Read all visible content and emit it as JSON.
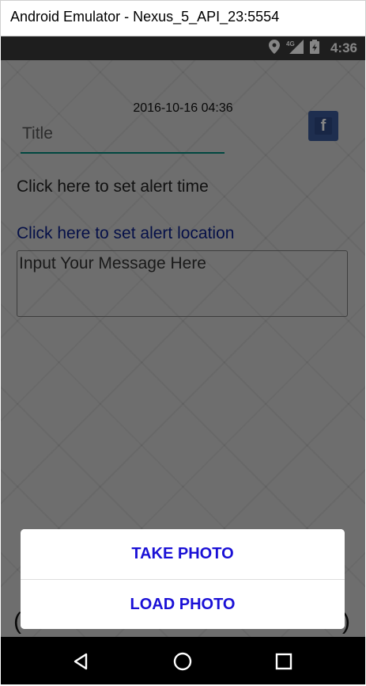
{
  "window": {
    "title": "Android Emulator - Nexus_5_API_23:5554"
  },
  "status_bar": {
    "time": "4:36",
    "network": "4G"
  },
  "form": {
    "datetime": "2016-10-16 04:36",
    "title_placeholder": "Title",
    "alert_time_link": "Click here to set alert time",
    "alert_location_link": "Click here to set alert location",
    "message_placeholder": "Input Your Message Here"
  },
  "dialog": {
    "take_photo": "TAKE PHOTO",
    "load_photo": "LOAD PHOTO"
  },
  "side_brackets": {
    "left": "(",
    "right": ")"
  },
  "colors": {
    "accent": "#00897b",
    "link": "#0b1f8a",
    "dialog_text": "#1a10d6",
    "facebook": "#3b5998"
  }
}
